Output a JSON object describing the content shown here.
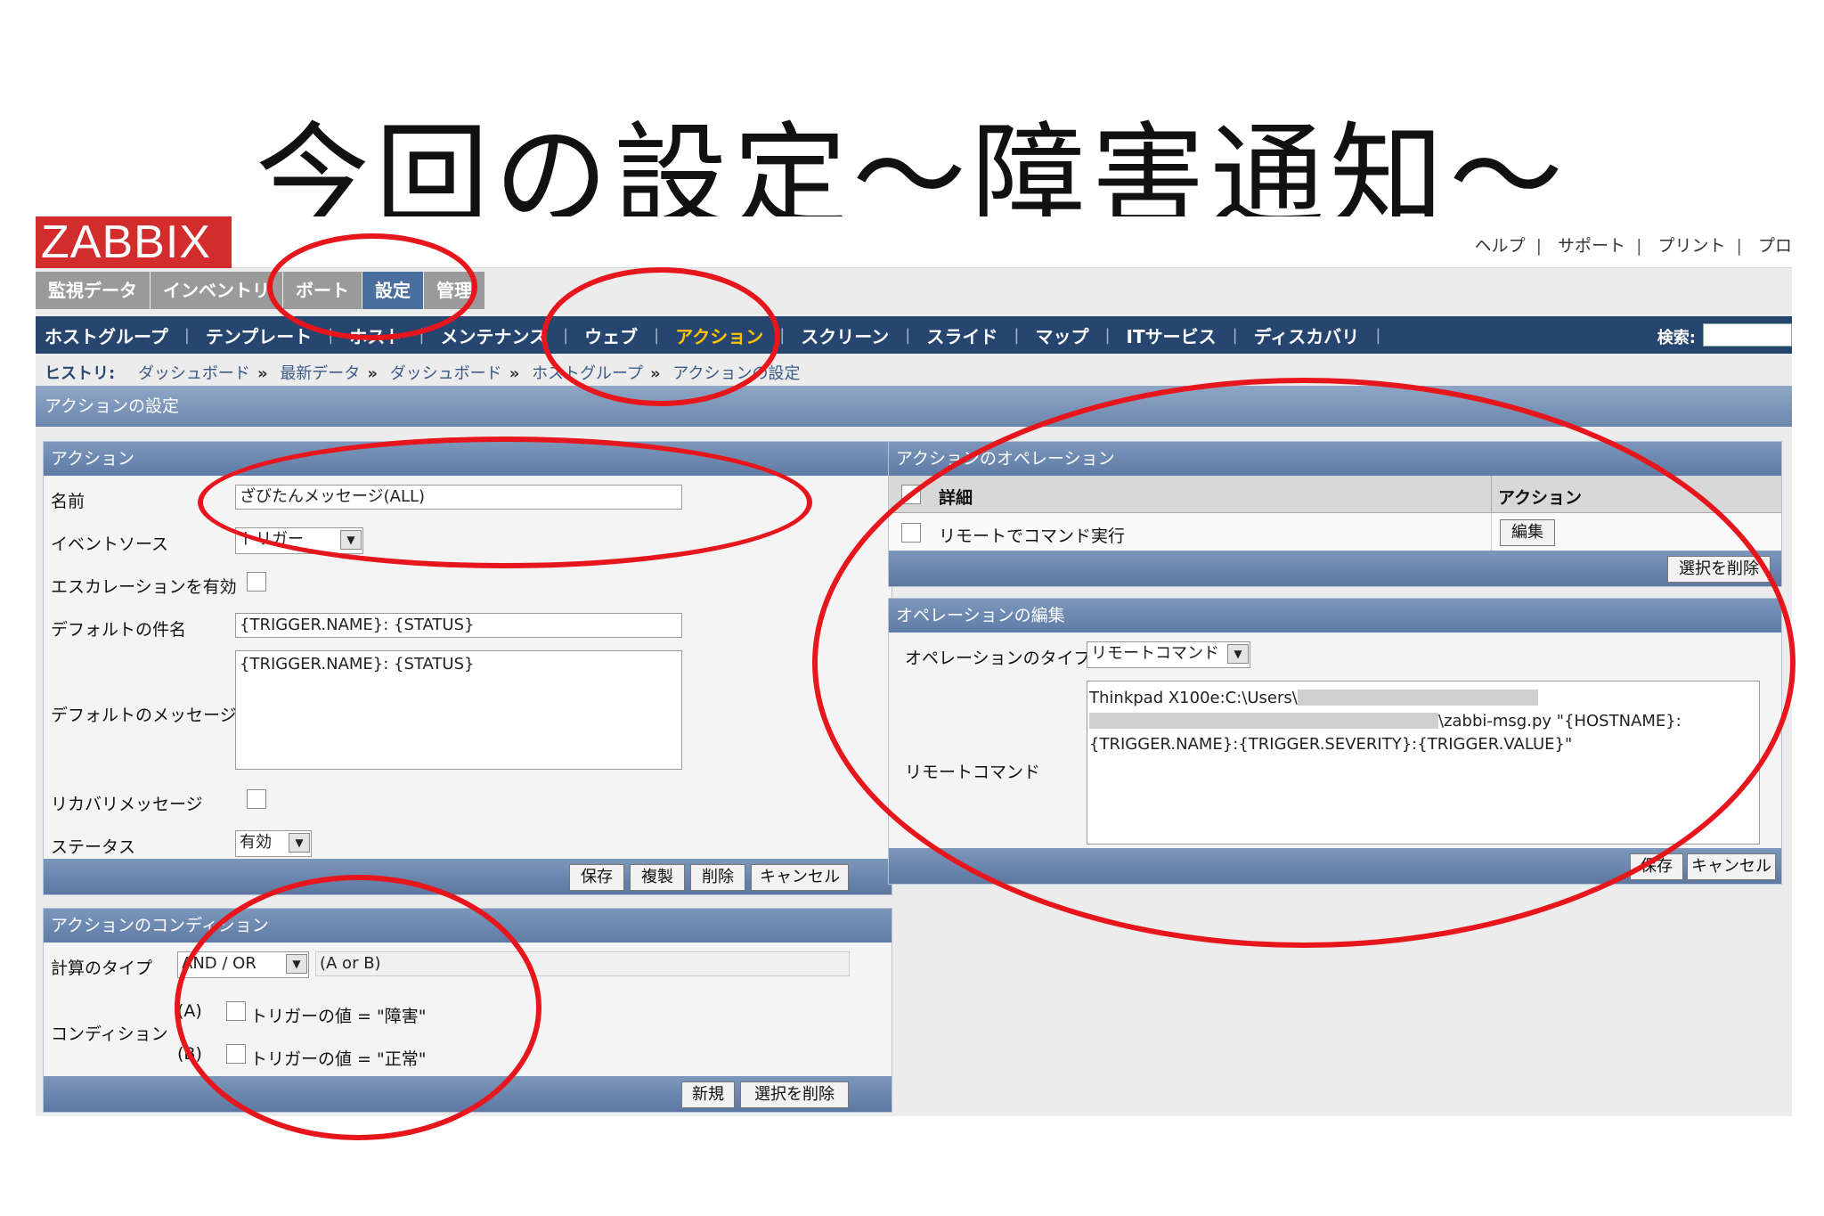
{
  "slide": {
    "title": "今回の設定～障害通知～"
  },
  "app": {
    "logo": "ZABBIX",
    "toplinks": [
      "ヘルプ",
      "サポート",
      "プリント",
      "プロ"
    ],
    "main_tabs": [
      "監視データ",
      "インベントリ",
      "ボート",
      "設定",
      "管理"
    ],
    "active_main_tab": "設定",
    "subnav": [
      "ホストグループ",
      "テンプレート",
      "ホスト",
      "メンテナンス",
      "ウェブ",
      "アクション",
      "スクリーン",
      "スライド",
      "マップ",
      "ITサービス",
      "ディスカバリ"
    ],
    "active_subnav": "アクション",
    "search_label": "検索:",
    "history_label": "ヒストリ:",
    "breadcrumbs": [
      "ダッシュボード",
      "最新データ",
      "ダッシュボード",
      "ホストグループ",
      "アクションの設定"
    ],
    "page_title": "アクションの設定"
  },
  "action_panel": {
    "title": "アクション",
    "labels": {
      "name": "名前",
      "event_source": "イベントソース",
      "escalation": "エスカレーションを有効",
      "default_subject": "デフォルトの件名",
      "default_message": "デフォルトのメッセージ",
      "recovery": "リカバリメッセージ",
      "status": "ステータス"
    },
    "values": {
      "name": "ざびたんメッセージ(ALL)",
      "event_source": "トリガー",
      "default_subject": "{TRIGGER.NAME}: {STATUS}",
      "default_message": "{TRIGGER.NAME}: {STATUS}",
      "status": "有効"
    },
    "buttons": [
      "保存",
      "複製",
      "削除",
      "キャンセル"
    ]
  },
  "conditions_panel": {
    "title": "アクションのコンディション",
    "calc_type_label": "計算のタイプ",
    "calc_type_value": "AND / OR",
    "calc_formula": "(A or B)",
    "condition_label": "コンディション",
    "conditions": [
      {
        "tag": "(A)",
        "text": "トリガーの値 = \"障害\""
      },
      {
        "tag": "(B)",
        "text": "トリガーの値 = \"正常\""
      }
    ],
    "buttons": [
      "新規",
      "選択を削除"
    ]
  },
  "operations_panel": {
    "title": "アクションのオペレーション",
    "columns": [
      "詳細",
      "アクション"
    ],
    "rows": [
      {
        "detail": "リモートでコマンド実行",
        "action": "編集"
      }
    ],
    "footer_button": "選択を削除"
  },
  "edit_panel": {
    "title": "オペレーションの編集",
    "type_label": "オペレーションのタイプ",
    "type_value": "リモートコマンド",
    "command_label": "リモートコマンド",
    "command_lines": [
      "Thinkpad X100e:C:\\Users\\",
      "\\zabbi-msg.py \"{HOSTNAME}:",
      "{TRIGGER.NAME}:{TRIGGER.SEVERITY}:{TRIGGER.VALUE}\""
    ],
    "buttons": [
      "保存",
      "キャンセル"
    ]
  },
  "colors": {
    "annotation_red": "#e6161c",
    "logo_red": "#d32c2c",
    "nav_blue": "#27466f",
    "active_nav": "#ffc400"
  }
}
